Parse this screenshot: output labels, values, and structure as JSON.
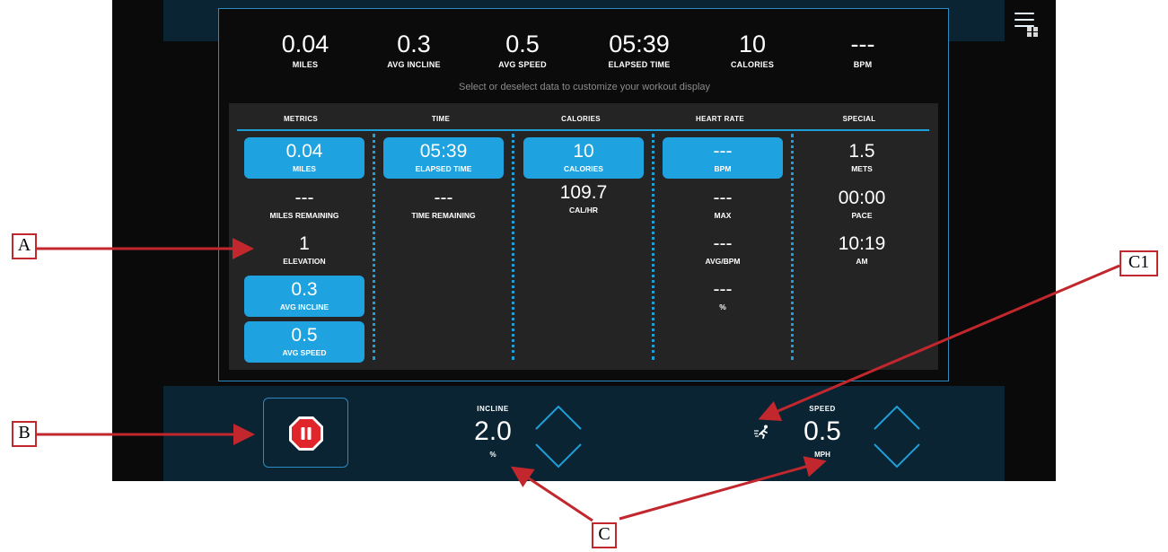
{
  "summary": [
    {
      "value": "0.04",
      "label": "MILES"
    },
    {
      "value": "0.3",
      "label": "AVG INCLINE"
    },
    {
      "value": "0.5",
      "label": "AVG SPEED"
    },
    {
      "value": "05:39",
      "label": "ELAPSED TIME"
    },
    {
      "value": "10",
      "label": "CALORIES"
    },
    {
      "value": "---",
      "label": "BPM"
    }
  ],
  "hint": "Select or deselect data to customize your workout display",
  "columns": [
    "METRICS",
    "TIME",
    "CALORIES",
    "HEART RATE",
    "SPECIAL"
  ],
  "metrics": [
    {
      "value": "0.04",
      "label": "MILES",
      "selected": true
    },
    {
      "value": "---",
      "label": "MILES REMAINING",
      "selected": false
    },
    {
      "value": "1",
      "label": "ELEVATION",
      "selected": false
    },
    {
      "value": "0.3",
      "label": "AVG INCLINE",
      "selected": true
    },
    {
      "value": "0.5",
      "label": "AVG SPEED",
      "selected": true
    }
  ],
  "time": [
    {
      "value": "05:39",
      "label": "ELAPSED TIME",
      "selected": true
    },
    {
      "value": "---",
      "label": "TIME REMAINING",
      "selected": false
    }
  ],
  "calories": [
    {
      "value": "10",
      "label": "CALORIES",
      "selected": true
    },
    {
      "value": "109.7",
      "label": "CAL/HR",
      "selected": false
    }
  ],
  "heart_rate": [
    {
      "value": "---",
      "label": "BPM",
      "selected": true
    },
    {
      "value": "---",
      "label": "MAX",
      "selected": false
    },
    {
      "value": "---",
      "label": "AVG/BPM",
      "selected": false
    },
    {
      "value": "---",
      "label": "%",
      "selected": false
    }
  ],
  "special": [
    {
      "value": "1.5",
      "label": "METS",
      "selected": false
    },
    {
      "value": "00:00",
      "label": "PACE",
      "selected": false
    },
    {
      "value": "10:19",
      "label": "AM",
      "selected": false
    }
  ],
  "controls": {
    "incline": {
      "label": "INCLINE",
      "value": "2.0",
      "unit": "%"
    },
    "speed": {
      "label": "SPEED",
      "value": "0.5",
      "unit": "MPH"
    }
  },
  "icons": {
    "menu": "hamburger-menu-icon",
    "fullscreen": "fullscreen-toggle-icon",
    "pause": "pause-stop-icon",
    "runner": "runner-icon",
    "increase": "chevron-up-icon",
    "decrease": "chevron-down-icon"
  },
  "annotations": {
    "a": "A",
    "b": "B",
    "c": "C",
    "c1": "C1"
  },
  "colors": {
    "accent": "#1ea3e0",
    "panel_border": "#2b8bc0",
    "pause_red": "#e0262b",
    "annotation_red": "#c1272d"
  }
}
